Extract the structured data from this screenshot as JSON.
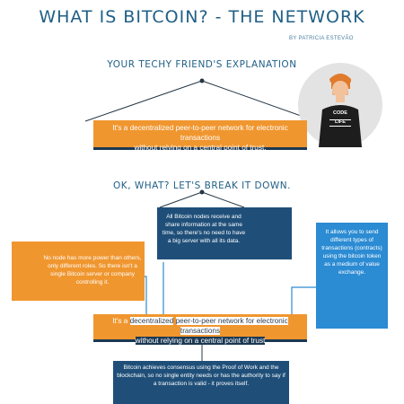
{
  "title": "WHAT IS BITCOIN? - THE NETWORK",
  "byline": "BY PATRICIA ESTEVÃO",
  "section1": {
    "heading": "YOUR TECHY FRIEND'S EXPLANATION",
    "definition_line1": "It's a decentralized peer-to-peer network for electronic transactions",
    "definition_line2": "without relying on a central point of trust.",
    "shirt_line1": "CODE",
    "shirt_line2": "LIFE"
  },
  "section2": {
    "heading": "OK, WHAT? LET'S BREAK IT DOWN.",
    "nodes_text": "All Bitcoin nodes receive and share information at the same time, so there's no need to have a big server with all its data.",
    "roles_text": "No node has more power than others, only different roles. So there isn't a single Bitcoin server or company controlling it.",
    "contracts_text": "It allows you to send different types of transactions (contracts) using the bitcoin token as a medium of value exchange.",
    "consensus_text": "Bitcoin achieves consensus using the Proof of Work and the blockchain, so no single entity needs or has the authority to say if a transaction is valid - it proves itself.",
    "sentence": {
      "prefix": "It's a ",
      "decentralized": "decentralized",
      "p2p": "peer-to-peer",
      "network_part": " network for electronic transactions",
      "line2": "without relying on a central point of trust"
    }
  },
  "colors": {
    "orange": "#f0962f",
    "dark_blue": "#1f4f79",
    "light_blue": "#2b8bd3",
    "title_blue": "#1f5f86"
  }
}
